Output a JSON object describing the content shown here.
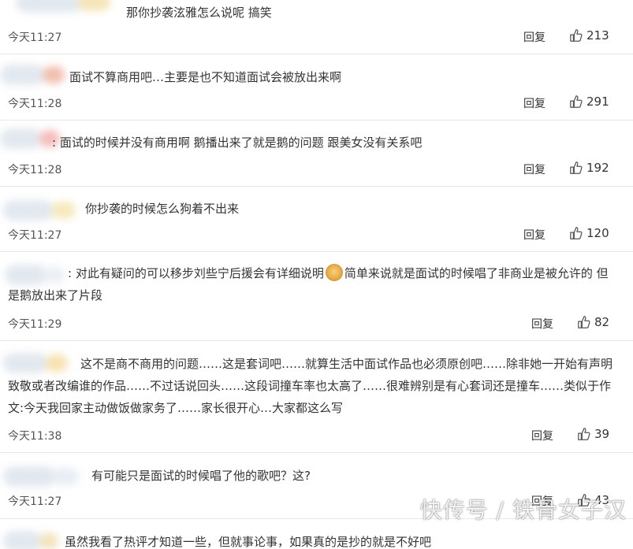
{
  "comments": [
    {
      "text": "那你抄袭泫雅怎么说呢 搞笑",
      "time": "今天11:27",
      "reply": "回复",
      "likes": "213",
      "accent": "#f3e3b0"
    },
    {
      "text": "面试不算商用吧…主要是也不知道面试会被放出来啊",
      "time": "今天11:28",
      "reply": "回复",
      "likes": "291",
      "accent": "#f0b8a6"
    },
    {
      "text": ": 面试的时候并没有商用啊 鹅播出来了就是鹅的问题 跟美女没有关系吧",
      "time": "今天11:28",
      "reply": "回复",
      "likes": "192",
      "accent": "#f4b6b6"
    },
    {
      "text": "你抄袭的时候怎么狗着不出来",
      "time": "今天11:27",
      "reply": "回复",
      "likes": "120",
      "accent": "#f6e7b6"
    },
    {
      "text_before_emoji": ": 对此有疑问的可以移步刘些宁后援会有详细说明",
      "text_after_emoji": "简单来说就是面试的时候唱了非商业是被允许的 但是鹅放出来了片段",
      "emoji": "doge-emoji",
      "time": "今天11:29",
      "reply": "回复",
      "likes": "82",
      "accent": "#e9eef4"
    },
    {
      "text": "这不是商不商用的问题……这是套词吧……就算生活中面试作品也必须原创吧……除非她一开始有声明致敬或者改编谁的作品……不过话说回头……这段词撞车率也太高了……很难辨别是有心套词还是撞车……类似于作文:今天我回家主动做饭做家务了……家长很开心…大家都这么写",
      "time": "今天11:38",
      "reply": "回复",
      "likes": "39",
      "accent": "#f6dfa8"
    },
    {
      "text": "有可能只是面试的时候唱了他的歌吧？这?",
      "time": "今天11:27",
      "reply": "回复",
      "likes": "43",
      "accent": "#e6ecf3"
    },
    {
      "text": "虽然我看了热评才知道一些，但就事论事，如果真的是抄的就是不好吧",
      "accent": "#f3e0b8"
    }
  ],
  "watermark": "快传号 / 铁骨女子汉"
}
